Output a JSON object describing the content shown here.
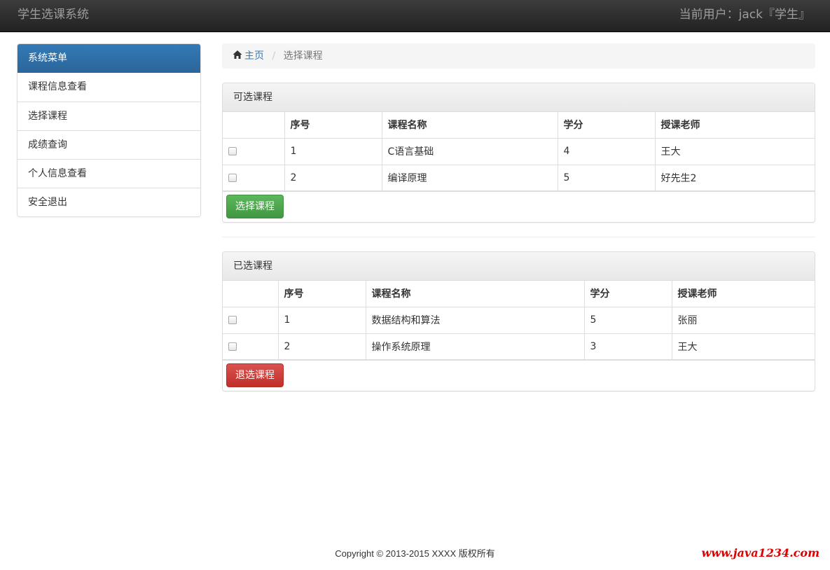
{
  "header": {
    "brand": "学生选课系统",
    "user_info": "当前用户：jack『学生』"
  },
  "sidebar": {
    "heading": "系统菜单",
    "items": [
      {
        "label": "课程信息查看"
      },
      {
        "label": "选择课程"
      },
      {
        "label": "成绩查询"
      },
      {
        "label": "个人信息查看"
      },
      {
        "label": "安全退出"
      }
    ]
  },
  "breadcrumb": {
    "home": "主页",
    "separator": "/",
    "current": "选择课程"
  },
  "available": {
    "title": "可选课程",
    "columns": [
      "序号",
      "课程名称",
      "学分",
      "授课老师"
    ],
    "rows": [
      {
        "no": "1",
        "name": "C语言基础",
        "credit": "4",
        "teacher": "王大"
      },
      {
        "no": "2",
        "name": "编译原理",
        "credit": "5",
        "teacher": "好先生2"
      }
    ],
    "button": "选择课程"
  },
  "selected": {
    "title": "已选课程",
    "columns": [
      "序号",
      "课程名称",
      "学分",
      "授课老师"
    ],
    "rows": [
      {
        "no": "1",
        "name": "数据结构和算法",
        "credit": "5",
        "teacher": "张丽"
      },
      {
        "no": "2",
        "name": "操作系统原理",
        "credit": "3",
        "teacher": "王大"
      }
    ],
    "button": "退选课程"
  },
  "footer": {
    "copyright": "Copyright © 2013-2015 XXXX 版权所有",
    "watermark": "www.java1234.com"
  },
  "colors": {
    "primary": "#337ab7",
    "success": "#5cb85c",
    "danger": "#d9534f",
    "navbar": "#222222",
    "watermark": "#e00000"
  }
}
